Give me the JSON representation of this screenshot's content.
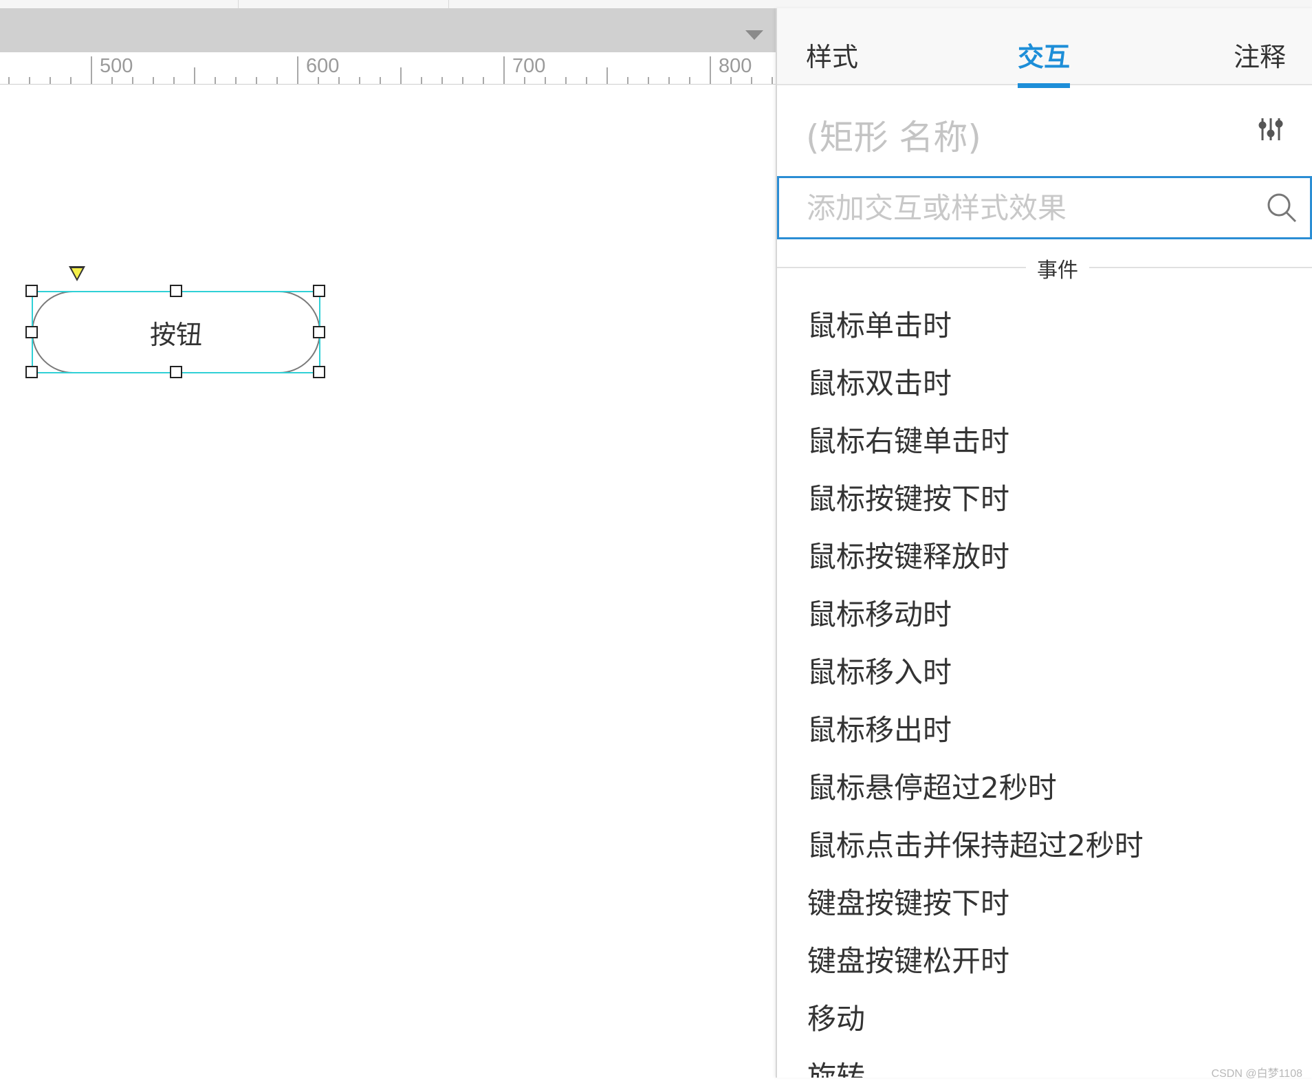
{
  "ruler": {
    "labels": [
      "500",
      "600",
      "700",
      "800"
    ]
  },
  "canvas": {
    "button_widget": {
      "label": "按钮"
    }
  },
  "panel": {
    "tabs": [
      {
        "label": "样式",
        "active": false
      },
      {
        "label": "交互",
        "active": true
      },
      {
        "label": "注释",
        "active": false
      }
    ],
    "element_name_placeholder": "(矩形 名称)",
    "search": {
      "placeholder": "添加交互或样式效果",
      "value": ""
    },
    "section_label": "事件",
    "events": [
      "鼠标单击时",
      "鼠标双击时",
      "鼠标右键单击时",
      "鼠标按键按下时",
      "鼠标按键释放时",
      "鼠标移动时",
      "鼠标移入时",
      "鼠标移出时",
      "鼠标悬停超过2秒时",
      "鼠标点击并保持超过2秒时",
      "键盘按键按下时",
      "键盘按键松开时",
      "移动",
      "旋转"
    ],
    "accent_color": "#1d8ed8"
  },
  "watermark": "CSDN @白梦1108"
}
